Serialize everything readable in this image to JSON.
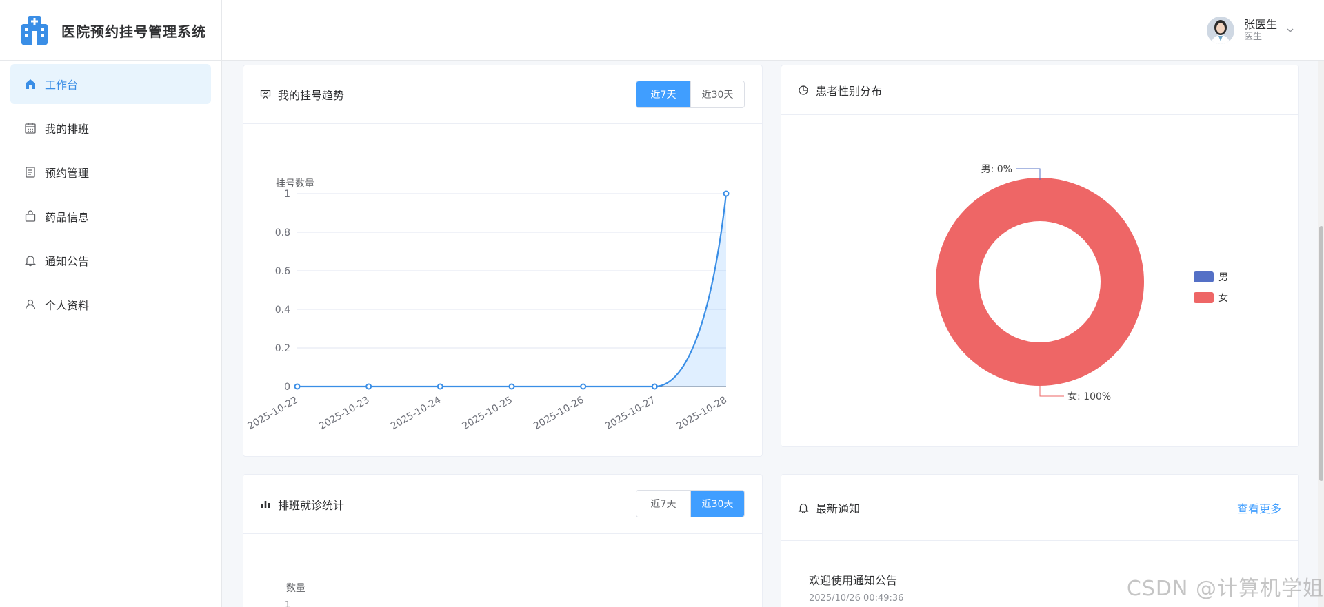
{
  "app": {
    "title": "医院预约挂号管理系统"
  },
  "user": {
    "name": "张医生",
    "role": "医生"
  },
  "sidebar": {
    "items": [
      {
        "label": "工作台",
        "icon": "home-icon",
        "active": true
      },
      {
        "label": "我的排班",
        "icon": "calendar-icon",
        "active": false
      },
      {
        "label": "预约管理",
        "icon": "document-icon",
        "active": false
      },
      {
        "label": "药品信息",
        "icon": "bag-icon",
        "active": false
      },
      {
        "label": "通知公告",
        "icon": "bell-icon",
        "active": false
      },
      {
        "label": "个人资料",
        "icon": "user-icon",
        "active": false
      }
    ]
  },
  "trend_card": {
    "title": "我的挂号趋势",
    "btn_7": "近7天",
    "btn_30": "近30天",
    "active": "7"
  },
  "gender_card": {
    "title": "患者性别分布"
  },
  "schedule_card": {
    "title": "排班就诊统计",
    "btn_7": "近7天",
    "btn_30": "近30天",
    "active": "30",
    "ylabel": "数量",
    "first_tick": "1"
  },
  "notice_card": {
    "title": "最新通知",
    "more": "查看更多",
    "items": [
      {
        "title": "欢迎使用通知公告",
        "time": "2025/10/26 00:49:36"
      }
    ]
  },
  "watermark": "CSDN @计算机学姐",
  "colors": {
    "primary": "#409eff",
    "male": "#5470c6",
    "female": "#ee6666",
    "line": "#3a8ee6"
  },
  "chart_data": [
    {
      "type": "line",
      "ylabel": "挂号数量",
      "x": [
        "2025-10-22",
        "2025-10-23",
        "2025-10-24",
        "2025-10-25",
        "2025-10-26",
        "2025-10-27",
        "2025-10-28"
      ],
      "values": [
        0,
        0,
        0,
        0,
        0,
        0,
        1
      ],
      "ylim": [
        0,
        1
      ],
      "yticks": [
        "0",
        "0.2",
        "0.4",
        "0.6",
        "0.8",
        "1"
      ],
      "grid": true,
      "area": true
    },
    {
      "type": "pie",
      "donut": true,
      "categories": [
        "男",
        "女"
      ],
      "values": [
        0,
        100
      ],
      "labels": [
        "男: 0%",
        "女: 100%"
      ],
      "legend": "right"
    }
  ]
}
